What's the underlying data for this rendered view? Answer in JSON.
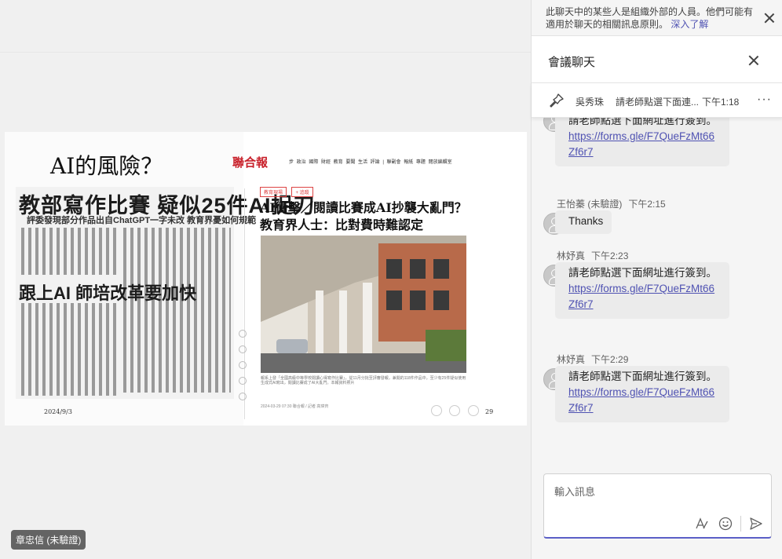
{
  "stage": {
    "presenter": "章忠信 (未驗證)",
    "slide": {
      "title": "AI的風險？",
      "clip_headline": "教部寫作比賽 疑似25件AI捉刀",
      "clip_subline": "評委發現部分作品出自ChatGPT一字未改 教育界憂如何規範",
      "clip_headline2": "跟上AI 師培改革要加快",
      "date": "2024/9/3",
      "brand": "聯合報",
      "nav": "步 政治 國際 財經 教育 要聞 生活 評論 | 聯副會 報紙 專題 閱放編輯室",
      "tags": [
        "教育現場",
        "+ 追蹤"
      ],
      "article_title_1": "AI衝擊／閱讀比賽成AI抄襲大亂門？",
      "article_title_2": "教育界人士：比對費時難認定",
      "caption": "報系上發「全國高級中等學校閱讀心得寫作比賽」，從11月分批至評審發報，兼閱的118件作品中，至少有25件疑似使用生成式AI寫出，閱讀比賽成了AI大亂門。本報資料照片",
      "meta": "2024-03-29 07:30  聯合報 / 記者 高瑋齊",
      "page_number": "29"
    }
  },
  "pane": {
    "banner": {
      "text": "此聊天中的某些人是組織外部的人員。他們可能有適用於聊天的相關訊息原則。",
      "link": "深入了解"
    },
    "header": {
      "title": "會議聊天"
    },
    "pinned": {
      "author": "吳秀珠",
      "message": "請老師點選下面連...",
      "time": "下午1:18"
    },
    "messages": [
      {
        "sender": "",
        "time": "",
        "text": "請老師點選下面網址進行簽到。",
        "link": "https://forms.gle/F7QueFzMt66Zf6r7"
      },
      {
        "sender": "王怡蓁 (未驗證)",
        "time": "下午2:15",
        "text": "Thanks",
        "link": ""
      },
      {
        "sender": "林妤真",
        "time": "下午2:23",
        "text": "請老師點選下面網址進行簽到。",
        "link": "https://forms.gle/F7QueFzMt66Zf6r7"
      },
      {
        "sender": "林妤真",
        "time": "下午2:29",
        "text": "請老師點選下面網址進行簽到。",
        "link": "https://forms.gle/F7QueFzMt66Zf6r7"
      }
    ],
    "compose": {
      "placeholder": "輸入訊息"
    }
  },
  "colors": {
    "accent": "#5b5fc7",
    "link": "#4f52b2",
    "brand_red": "#c8202a"
  }
}
